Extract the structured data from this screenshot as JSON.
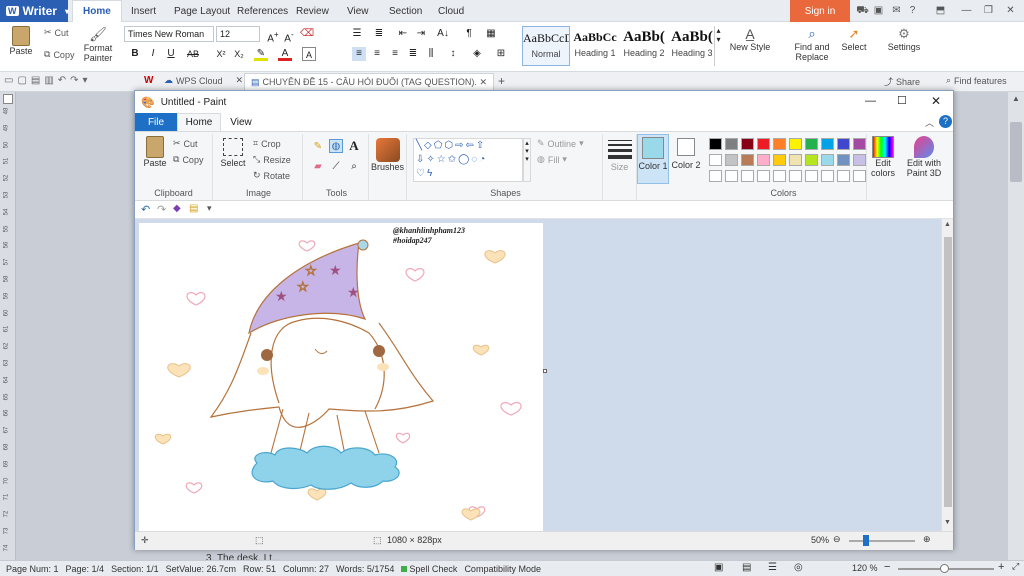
{
  "wps": {
    "app_name": "Writer",
    "menu_tabs": [
      "Home",
      "Insert",
      "Page Layout",
      "References",
      "Review",
      "View",
      "Section",
      "Cloud"
    ],
    "sign_in": "Sign in",
    "clipboard": {
      "paste": "Paste",
      "cut": "Cut",
      "copy": "Copy",
      "format_painter_1": "Format",
      "format_painter_2": "Painter"
    },
    "font_name": "Times New Roman",
    "font_size": "12",
    "styles": [
      {
        "preview": "AaBbCcD",
        "name": "Normal"
      },
      {
        "preview": "AaBbCc",
        "name": "Heading 1"
      },
      {
        "preview": "AaBb(",
        "name": "Heading 2"
      },
      {
        "preview": "AaBb(",
        "name": "Heading 3"
      }
    ],
    "new_style": "New Style",
    "find_replace_1": "Find and",
    "find_replace_2": "Replace",
    "select": "Select",
    "settings": "Settings",
    "doc_tabs": {
      "cloud": "WPS Cloud",
      "document": "CHUYÊN ĐỀ 15 - CÂU HỎI ĐUÔI (TAG QUESTION).doc"
    },
    "share": "Share",
    "find_features": "Find features",
    "ruler_numbers": [
      "48",
      "49",
      "50",
      "51",
      "52",
      "53",
      "54",
      "55",
      "56",
      "57",
      "58",
      "59",
      "60",
      "61",
      "62",
      "63",
      "64",
      "65",
      "66",
      "67",
      "68",
      "69",
      "70",
      "71",
      "72",
      "73",
      "74"
    ],
    "status": {
      "page_num": "Page Num: 1",
      "page": "Page: 1/4",
      "section": "Section: 1/1",
      "set_value": "SetValue: 26.7cm",
      "row": "Row: 51",
      "column": "Column: 27",
      "words": "Words: 5/1754",
      "spell_check": "Spell Check",
      "compat": "Compatibility Mode",
      "zoom": "120 %"
    },
    "doc_peek_text": "3. The desk, I t..."
  },
  "paint": {
    "title": "Untitled - Paint",
    "menu": {
      "file": "File",
      "home": "Home",
      "view": "View"
    },
    "clipboard": {
      "paste": "Paste",
      "cut": "Cut",
      "copy": "Copy",
      "label": "Clipboard"
    },
    "image": {
      "select": "Select",
      "crop": "Crop",
      "resize": "Resize",
      "rotate": "Rotate",
      "label": "Image"
    },
    "tools": {
      "label": "Tools"
    },
    "brushes": "Brushes",
    "shapes": {
      "outline": "Outline",
      "fill": "Fill",
      "label": "Shapes"
    },
    "size": "Size",
    "color1": "Color 1",
    "color2": "Color 2",
    "colors_label": "Colors",
    "edit_colors_1": "Edit",
    "edit_colors_2": "colors",
    "edit_3d_1": "Edit with",
    "edit_3d_2": "Paint 3D",
    "palette": [
      "#000000",
      "#7f7f7f",
      "#880015",
      "#ed1c24",
      "#ff7f27",
      "#fff200",
      "#22b14c",
      "#00a2e8",
      "#3f48cc",
      "#a349a4",
      "#ffffff",
      "#c3c3c3",
      "#b97a57",
      "#ffaec9",
      "#ffc90e",
      "#efe4b0",
      "#b5e61d",
      "#99d9ea",
      "#7092be",
      "#c8bfe7"
    ],
    "color1_value": "#99d9ea",
    "canvas_text_1": "@khanhlinhpham123",
    "canvas_text_2": "#hoidap247",
    "canvas_size": "1080 × 828px",
    "zoom": "50%"
  }
}
